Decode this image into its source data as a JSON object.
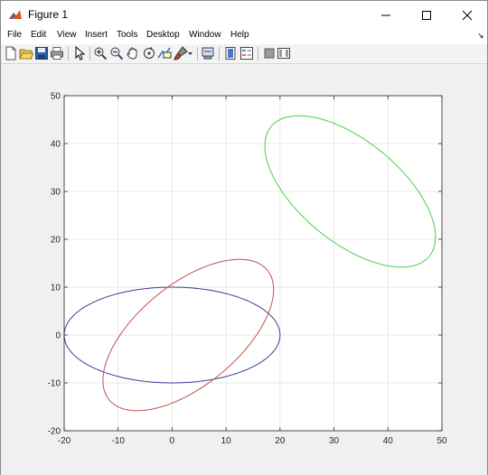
{
  "window": {
    "title": "Figure 1",
    "icon": "matlab-figure-icon"
  },
  "menu": {
    "items": [
      "File",
      "Edit",
      "View",
      "Insert",
      "Tools",
      "Desktop",
      "Window",
      "Help"
    ],
    "dock_glyph": "↘"
  },
  "toolbar": {
    "icons": [
      "new-figure-icon",
      "open-file-icon",
      "save-icon",
      "print-icon",
      "pointer-icon",
      "zoom-in-icon",
      "zoom-out-icon",
      "pan-icon",
      "rotate-3d-icon",
      "data-cursor-icon",
      "brush-icon",
      "brush-dropdown-icon",
      "link-plot-icon",
      "insert-colorbar-icon",
      "insert-legend-icon",
      "hide-plot-tools-icon",
      "show-plot-tools-icon"
    ]
  },
  "chart_data": {
    "type": "line",
    "title": "",
    "xlabel": "",
    "ylabel": "",
    "xlim": [
      -20,
      50
    ],
    "ylim": [
      -20,
      50
    ],
    "xticks": [
      -20,
      -10,
      0,
      10,
      20,
      30,
      40,
      50
    ],
    "yticks": [
      -20,
      -10,
      0,
      10,
      20,
      30,
      40,
      50
    ],
    "grid": true,
    "series": [
      {
        "color": "#3b3b9e",
        "shape": "ellipse",
        "center": [
          0,
          0
        ],
        "semi_axes": [
          20,
          10
        ],
        "rotation_deg": 0
      },
      {
        "color": "#c0504d",
        "shape": "ellipse",
        "center": [
          3,
          0
        ],
        "semi_axes": [
          20,
          10
        ],
        "rotation_deg": 45
      },
      {
        "color": "#4ccc4c",
        "shape": "ellipse",
        "center": [
          33,
          30
        ],
        "semi_axes": [
          20,
          10
        ],
        "rotation_deg": -45
      }
    ]
  }
}
